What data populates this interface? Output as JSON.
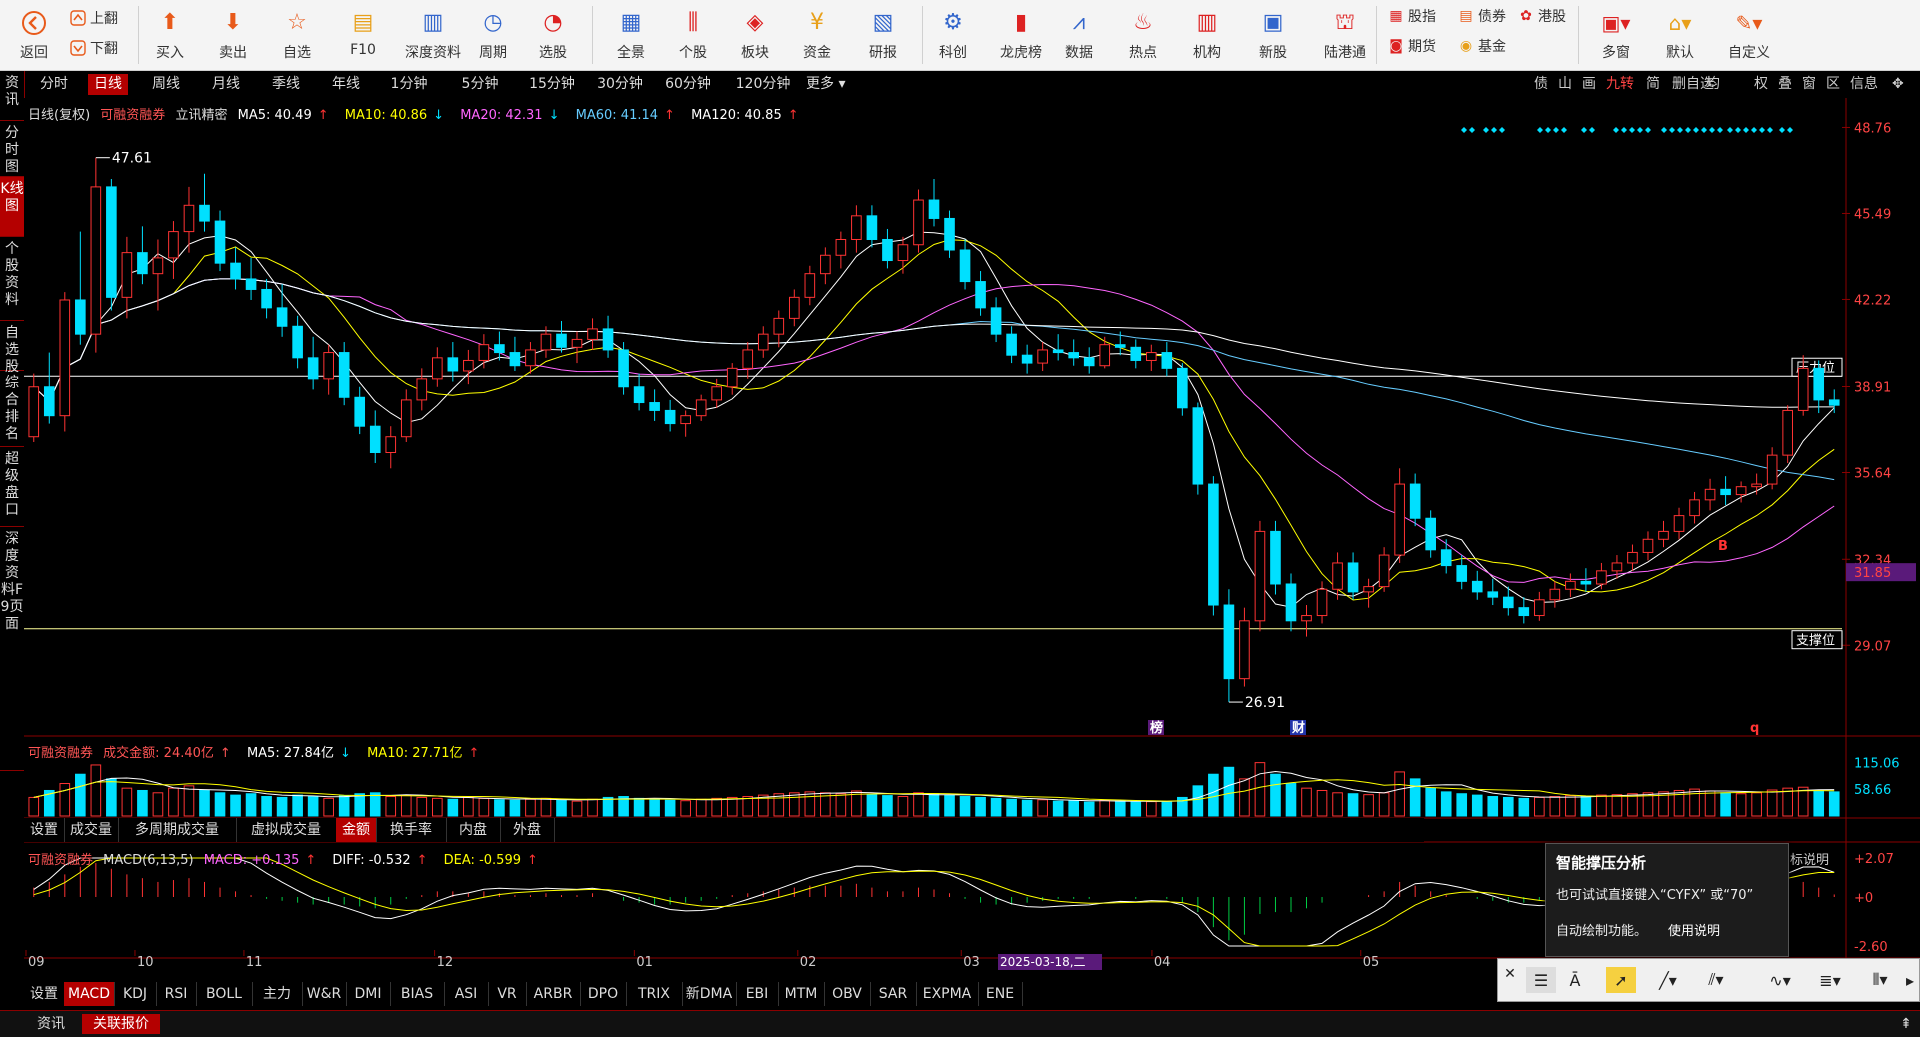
{
  "toolbar": {
    "nav": [
      {
        "label": "返回",
        "icon": "back-icon"
      }
    ],
    "updown": [
      {
        "label": "上翻",
        "icon": "page-up-icon"
      },
      {
        "label": "下翻",
        "icon": "page-down-icon"
      }
    ],
    "buttons": [
      {
        "label": "买入",
        "icon": "buy-icon"
      },
      {
        "label": "卖出",
        "icon": "sell-icon"
      },
      {
        "label": "自选",
        "icon": "star-icon"
      },
      {
        "label": "F10",
        "icon": "f10-icon"
      },
      {
        "label": "深度资料",
        "icon": "f9-icon"
      },
      {
        "label": "周期",
        "icon": "clock-icon"
      },
      {
        "label": "选股",
        "icon": "stock-pick-icon"
      },
      {
        "label": "全景",
        "icon": "grid-icon"
      },
      {
        "label": "个股",
        "icon": "candle-icon"
      },
      {
        "label": "板块",
        "icon": "layers-icon"
      },
      {
        "label": "资金",
        "icon": "yen-icon"
      },
      {
        "label": "研报",
        "icon": "report-icon"
      },
      {
        "label": "科创",
        "icon": "kechuang-icon"
      },
      {
        "label": "龙虎榜",
        "icon": "bar-chart-icon"
      },
      {
        "label": "数据",
        "icon": "data-chart-icon"
      },
      {
        "label": "热点",
        "icon": "flame-icon"
      },
      {
        "label": "机构",
        "icon": "institution-icon"
      },
      {
        "label": "新股",
        "icon": "ipo-icon"
      },
      {
        "label": "陆港通",
        "icon": "hk-connect-icon"
      }
    ],
    "mini": [
      {
        "label": "股指",
        "icon": "index-futures-icon"
      },
      {
        "label": "债券",
        "icon": "bond-icon"
      },
      {
        "label": "港股",
        "icon": "hk-stock-icon"
      },
      {
        "label": "期货",
        "icon": "futures-icon"
      },
      {
        "label": "基金",
        "icon": "fund-icon"
      }
    ],
    "right": [
      {
        "label": "多窗",
        "icon": "multi-window-icon"
      },
      {
        "label": "默认",
        "icon": "home-icon"
      },
      {
        "label": "自定义",
        "icon": "customize-icon"
      }
    ]
  },
  "periods": [
    "分时",
    "日线",
    "周线",
    "月线",
    "季线",
    "年线",
    "1分钟",
    "5分钟",
    "15分钟",
    "30分钟",
    "60分钟",
    "120分钟",
    "更多"
  ],
  "periods_active": "日线",
  "right_tools": [
    "债",
    "山",
    "画",
    "九转",
    "简",
    "删自选",
    "均",
    "权",
    "叠",
    "窗",
    "区",
    "信息",
    "✥"
  ],
  "left_tabs": [
    "资讯",
    "分时图",
    "K线图",
    "个股资料",
    "自选股",
    "综合排名",
    "超级盘口",
    "深度资料F9页面"
  ],
  "left_tab_active": "K线图",
  "main_info": {
    "period": "日线(复权)",
    "name": "可融资融券",
    "indicator": "立讯精密",
    "ma5": "MA5: 40.49",
    "ma10": "MA10: 40.86",
    "ma20": "MA20: 42.31",
    "ma60": "MA60: 41.14",
    "ma120": "MA120: 40.85"
  },
  "vol_info": {
    "name": "可融资融券",
    "amount": "成交金额: 24.40亿",
    "ma5": "MA5: 27.84亿",
    "ma10": "MA10: 27.71亿"
  },
  "macd_info": {
    "name": "可融资融券",
    "title": "MACD(6,13,5)",
    "macd": "MACD: +0.135",
    "diff": "DIFF: -0.532",
    "dea": "DEA: -0.599"
  },
  "price_axis": [
    "48.76",
    "45.49",
    "42.22",
    "38.91",
    "35.64",
    "32.34",
    "29.07"
  ],
  "current_price": "31.85",
  "vol_axis": [
    "115.06",
    "58.66"
  ],
  "macd_axis": [
    "+2.07",
    "+0",
    "-2.60"
  ],
  "date_axis": [
    {
      "label": "09",
      "x": 0.0
    },
    {
      "label": "10",
      "x": 0.06
    },
    {
      "label": "11",
      "x": 0.12
    },
    {
      "label": "12",
      "x": 0.225
    },
    {
      "label": "01",
      "x": 0.335
    },
    {
      "label": "02",
      "x": 0.425
    },
    {
      "label": "03",
      "x": 0.515
    },
    {
      "label": "04",
      "x": 0.62
    },
    {
      "label": "05",
      "x": 0.735
    }
  ],
  "cursor_date": "2025-03-18,二",
  "annotations": {
    "high": "47.61",
    "low": "26.91",
    "resistance": "压力位",
    "support": "支撑位",
    "marker_bang": "榜",
    "marker_cai": "财",
    "marker_q": "q",
    "marker_b": "B"
  },
  "volume_tabs": [
    "设置",
    "成交量",
    "多周期成交量",
    "虚拟成交量",
    "金额",
    "换手率",
    "内盘",
    "外盘"
  ],
  "volume_tab_active": "金额",
  "indicator_tabs": [
    "设置",
    "MACD",
    "KDJ",
    "RSI",
    "BOLL",
    "主力",
    "W&R",
    "DMI",
    "BIAS",
    "ASI",
    "VR",
    "ARBR",
    "DPO",
    "TRIX",
    "新DMA",
    "EBI",
    "MTM",
    "OBV",
    "SAR",
    "EXPMA",
    "ENE"
  ],
  "indicator_tab_active": "MACD",
  "bottom_tabs": [
    "资讯",
    "关联报价"
  ],
  "bottom_tab_active": "关联报价",
  "popup": {
    "title": "智能撑压分析",
    "line1": "也可试试直接键入“CYFX” 或“70”",
    "line2": "自动绘制功能。",
    "link": "使用说明",
    "behind_text": "标说明"
  },
  "colors": {
    "up": "#ff3333",
    "down": "#00e0ff",
    "ma5": "#ffffff",
    "ma10": "#ffff00",
    "ma20": "#ff66ff",
    "ma60": "#66ccff",
    "ma120": "#ffffff",
    "accent": "#b40000"
  },
  "chart_data": {
    "type": "candlestick",
    "price_range": [
      26.0,
      49.5
    ],
    "resistance": 39.3,
    "support": 29.7,
    "ohlc": [
      [
        37.0,
        39.4,
        36.8,
        38.9
      ],
      [
        38.9,
        40.2,
        37.5,
        37.8
      ],
      [
        37.8,
        42.5,
        37.2,
        42.2
      ],
      [
        42.2,
        44.8,
        40.5,
        40.9
      ],
      [
        40.9,
        47.61,
        40.2,
        46.5
      ],
      [
        46.5,
        46.8,
        41.8,
        42.3
      ],
      [
        42.3,
        44.6,
        41.5,
        44.0
      ],
      [
        44.0,
        45.0,
        42.8,
        43.2
      ],
      [
        43.2,
        44.5,
        41.8,
        43.8
      ],
      [
        43.8,
        45.2,
        43.0,
        44.8
      ],
      [
        44.8,
        46.5,
        44.0,
        45.8
      ],
      [
        45.8,
        47.0,
        44.8,
        45.2
      ],
      [
        45.2,
        45.6,
        43.3,
        43.6
      ],
      [
        43.6,
        44.2,
        42.6,
        43.0
      ],
      [
        43.0,
        43.8,
        42.2,
        42.6
      ],
      [
        42.6,
        43.0,
        41.5,
        41.9
      ],
      [
        41.9,
        42.8,
        40.8,
        41.2
      ],
      [
        41.2,
        41.6,
        39.6,
        40.0
      ],
      [
        40.0,
        40.8,
        38.8,
        39.2
      ],
      [
        39.2,
        40.5,
        38.6,
        40.2
      ],
      [
        40.2,
        40.6,
        38.2,
        38.5
      ],
      [
        38.5,
        38.9,
        37.1,
        37.4
      ],
      [
        37.4,
        38.0,
        36.0,
        36.4
      ],
      [
        36.4,
        37.4,
        35.8,
        37.0
      ],
      [
        37.0,
        38.8,
        36.8,
        38.4
      ],
      [
        38.4,
        39.6,
        38.0,
        39.2
      ],
      [
        39.2,
        40.4,
        38.9,
        40.0
      ],
      [
        40.0,
        40.6,
        39.1,
        39.5
      ],
      [
        39.5,
        40.3,
        39.0,
        39.9
      ],
      [
        39.9,
        40.9,
        39.6,
        40.5
      ],
      [
        40.5,
        41.0,
        39.9,
        40.2
      ],
      [
        40.2,
        40.8,
        39.5,
        39.7
      ],
      [
        39.7,
        40.6,
        39.4,
        40.3
      ],
      [
        40.3,
        41.2,
        40.0,
        40.9
      ],
      [
        40.9,
        41.4,
        40.2,
        40.4
      ],
      [
        40.4,
        41.0,
        39.8,
        40.7
      ],
      [
        40.7,
        41.5,
        40.3,
        41.1
      ],
      [
        41.1,
        41.6,
        40.0,
        40.3
      ],
      [
        40.3,
        40.6,
        38.6,
        38.9
      ],
      [
        38.9,
        39.4,
        38.0,
        38.3
      ],
      [
        38.3,
        38.8,
        37.6,
        38.0
      ],
      [
        38.0,
        38.4,
        37.2,
        37.5
      ],
      [
        37.5,
        38.0,
        37.0,
        37.8
      ],
      [
        37.8,
        38.6,
        37.6,
        38.4
      ],
      [
        38.4,
        39.2,
        38.1,
        38.9
      ],
      [
        38.9,
        39.8,
        38.6,
        39.6
      ],
      [
        39.6,
        40.6,
        39.2,
        40.3
      ],
      [
        40.3,
        41.2,
        40.0,
        40.9
      ],
      [
        40.9,
        41.8,
        40.4,
        41.5
      ],
      [
        41.5,
        42.6,
        41.2,
        42.3
      ],
      [
        42.3,
        43.5,
        42.0,
        43.2
      ],
      [
        43.2,
        44.2,
        42.8,
        43.9
      ],
      [
        43.9,
        44.8,
        43.4,
        44.5
      ],
      [
        44.5,
        45.8,
        44.0,
        45.4
      ],
      [
        45.4,
        45.8,
        44.2,
        44.5
      ],
      [
        44.5,
        44.9,
        43.4,
        43.7
      ],
      [
        43.7,
        44.6,
        43.2,
        44.3
      ],
      [
        44.3,
        46.4,
        44.0,
        46.0
      ],
      [
        46.0,
        46.8,
        45.0,
        45.3
      ],
      [
        45.3,
        45.6,
        43.8,
        44.1
      ],
      [
        44.1,
        44.5,
        42.6,
        42.9
      ],
      [
        42.9,
        43.3,
        41.6,
        41.9
      ],
      [
        41.9,
        42.3,
        40.6,
        40.9
      ],
      [
        40.9,
        41.2,
        39.8,
        40.1
      ],
      [
        40.1,
        40.5,
        39.4,
        39.8
      ],
      [
        39.8,
        40.6,
        39.5,
        40.3
      ],
      [
        40.3,
        40.9,
        39.9,
        40.2
      ],
      [
        40.2,
        40.7,
        39.7,
        40.0
      ],
      [
        40.0,
        40.4,
        39.4,
        39.7
      ],
      [
        39.7,
        40.8,
        39.6,
        40.5
      ],
      [
        40.5,
        41.0,
        40.1,
        40.4
      ],
      [
        40.4,
        40.7,
        39.6,
        39.9
      ],
      [
        39.9,
        40.5,
        39.5,
        40.2
      ],
      [
        40.2,
        40.6,
        39.3,
        39.6
      ],
      [
        39.6,
        39.8,
        37.8,
        38.1
      ],
      [
        38.1,
        38.3,
        34.8,
        35.2
      ],
      [
        35.2,
        35.5,
        30.2,
        30.6
      ],
      [
        30.6,
        31.2,
        26.91,
        27.8
      ],
      [
        27.8,
        30.5,
        27.5,
        30.0
      ],
      [
        30.0,
        33.8,
        29.6,
        33.4
      ],
      [
        33.4,
        33.8,
        31.0,
        31.4
      ],
      [
        31.4,
        31.8,
        29.6,
        30.0
      ],
      [
        30.0,
        30.6,
        29.4,
        30.2
      ],
      [
        30.2,
        31.5,
        29.9,
        31.2
      ],
      [
        31.2,
        32.6,
        30.8,
        32.2
      ],
      [
        32.2,
        32.6,
        30.8,
        31.1
      ],
      [
        31.1,
        31.6,
        30.5,
        31.3
      ],
      [
        31.3,
        32.8,
        31.1,
        32.5
      ],
      [
        32.5,
        35.8,
        32.2,
        35.2
      ],
      [
        35.2,
        35.6,
        33.6,
        33.9
      ],
      [
        33.9,
        34.2,
        32.4,
        32.7
      ],
      [
        32.7,
        33.1,
        31.8,
        32.1
      ],
      [
        32.1,
        32.5,
        31.2,
        31.5
      ],
      [
        31.5,
        31.9,
        30.8,
        31.1
      ],
      [
        31.1,
        31.6,
        30.6,
        30.9
      ],
      [
        30.9,
        31.3,
        30.2,
        30.5
      ],
      [
        30.5,
        30.9,
        29.9,
        30.2
      ],
      [
        30.2,
        31.1,
        30.0,
        30.8
      ],
      [
        30.8,
        31.5,
        30.5,
        31.2
      ],
      [
        31.2,
        31.8,
        30.9,
        31.5
      ],
      [
        31.5,
        32.0,
        31.1,
        31.4
      ],
      [
        31.4,
        32.2,
        31.2,
        31.9
      ],
      [
        31.9,
        32.5,
        31.6,
        32.2
      ],
      [
        32.2,
        32.9,
        31.9,
        32.6
      ],
      [
        32.6,
        33.4,
        32.3,
        33.1
      ],
      [
        33.1,
        33.8,
        32.8,
        33.4
      ],
      [
        33.4,
        34.3,
        33.1,
        34.0
      ],
      [
        34.0,
        34.9,
        33.7,
        34.6
      ],
      [
        34.6,
        35.4,
        34.2,
        35.0
      ],
      [
        35.0,
        35.5,
        34.4,
        34.8
      ],
      [
        34.8,
        35.3,
        34.5,
        35.1
      ],
      [
        35.1,
        35.6,
        34.8,
        35.2
      ],
      [
        35.2,
        36.6,
        35.0,
        36.3
      ],
      [
        36.3,
        38.2,
        36.0,
        38.0
      ],
      [
        38.0,
        40.1,
        37.8,
        39.6
      ],
      [
        39.6,
        39.9,
        37.9,
        38.4
      ],
      [
        38.4,
        38.8,
        37.9,
        38.2
      ]
    ],
    "amount": [
      40,
      55,
      70,
      90,
      110,
      80,
      60,
      55,
      50,
      60,
      65,
      55,
      50,
      45,
      48,
      42,
      40,
      45,
      42,
      38,
      44,
      48,
      50,
      42,
      45,
      40,
      38,
      36,
      40,
      38,
      35,
      34,
      36,
      38,
      34,
      32,
      36,
      40,
      42,
      38,
      35,
      34,
      33,
      36,
      38,
      40,
      42,
      45,
      48,
      50,
      52,
      50,
      48,
      54,
      46,
      44,
      42,
      50,
      48,
      45,
      42,
      40,
      38,
      36,
      34,
      35,
      32,
      33,
      30,
      34,
      32,
      30,
      31,
      30,
      40,
      65,
      90,
      105,
      80,
      115,
      90,
      70,
      60,
      55,
      50,
      48,
      46,
      50,
      95,
      80,
      60,
      52,
      48,
      45,
      42,
      40,
      38,
      40,
      42,
      44,
      42,
      45,
      46,
      48,
      50,
      52,
      55,
      58,
      54,
      50,
      48,
      50,
      56,
      60,
      62,
      55,
      52
    ],
    "macd": [
      0.5,
      0.8,
      1.2,
      1.6,
      1.8,
      1.5,
      1.2,
      1.0,
      0.8,
      0.9,
      1.0,
      0.8,
      0.5,
      0.3,
      0.1,
      -0.1,
      -0.2,
      -0.3,
      -0.4,
      -0.3,
      -0.4,
      -0.5,
      -0.6,
      -0.4,
      -0.1,
      0.1,
      0.3,
      0.3,
      0.2,
      0.3,
      0.2,
      0.1,
      0.1,
      0.2,
      0.1,
      0.1,
      0.2,
      0.0,
      -0.2,
      -0.3,
      -0.4,
      -0.4,
      -0.3,
      -0.2,
      -0.1,
      0.1,
      0.2,
      0.3,
      0.4,
      0.5,
      0.6,
      0.6,
      0.6,
      0.7,
      0.5,
      0.3,
      0.3,
      0.5,
      0.4,
      0.2,
      -0.1,
      -0.3,
      -0.4,
      -0.4,
      -0.3,
      -0.2,
      -0.1,
      -0.1,
      -0.1,
      0.0,
      0.0,
      -0.1,
      0.0,
      -0.1,
      -0.3,
      -0.8,
      -1.6,
      -2.3,
      -2.0,
      -0.9,
      -0.8,
      -0.8,
      -0.6,
      -0.3,
      0.0,
      0.0,
      0.1,
      0.3,
      0.8,
      0.6,
      0.3,
      0.1,
      0.0,
      -0.1,
      -0.2,
      -0.3,
      -0.3,
      -0.2,
      -0.1,
      0.0,
      0.0,
      0.1,
      0.1,
      0.2,
      0.2,
      0.3,
      0.3,
      0.4,
      0.4,
      0.3,
      0.3,
      0.3,
      0.4,
      0.6,
      0.8,
      0.5,
      0.135
    ]
  }
}
